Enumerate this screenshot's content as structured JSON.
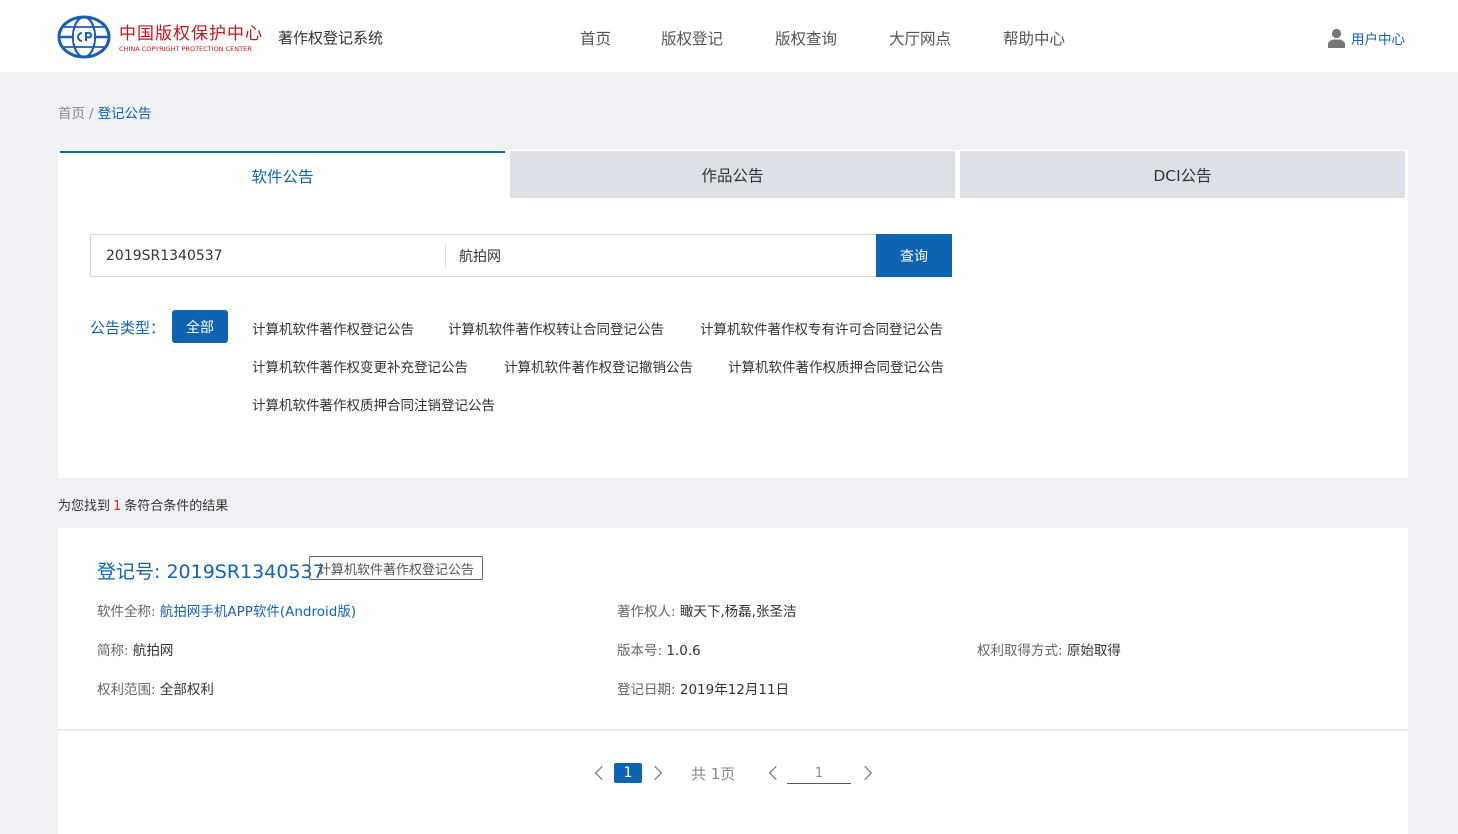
{
  "header": {
    "logo_cn": "中国版权保护中心",
    "logo_en": "CHINA COPYRIGHT PROTECTION CENTER",
    "system_title": "著作权登记系统",
    "nav": [
      {
        "label": "首页"
      },
      {
        "label": "版权登记"
      },
      {
        "label": "版权查询"
      },
      {
        "label": "大厅网点"
      },
      {
        "label": "帮助中心"
      }
    ],
    "user_center": "用户中心"
  },
  "breadcrumb": {
    "home": "首页",
    "separator": "/",
    "current": "登记公告"
  },
  "tabs": [
    {
      "label": "软件公告",
      "active": true
    },
    {
      "label": "作品公告",
      "active": false
    },
    {
      "label": "DCI公告",
      "active": false
    }
  ],
  "search": {
    "registration_value": "2019SR1340537",
    "name_value": "航拍网",
    "button_label": "查询"
  },
  "filter": {
    "label": "公告类型：",
    "all_label": "全部",
    "types": [
      "计算机软件著作权登记公告",
      "计算机软件著作权转让合同登记公告",
      "计算机软件著作权专有许可合同登记公告",
      "计算机软件著作权变更补充登记公告",
      "计算机软件著作权登记撤销公告",
      "计算机软件著作权质押合同登记公告",
      "计算机软件著作权质押合同注销登记公告"
    ]
  },
  "results": {
    "prefix": "为您找到",
    "count": "1",
    "suffix": "条符合条件的结果"
  },
  "record": {
    "reg_no_label": "登记号: 2019SR1340537",
    "badge": "计算机软件著作权登记公告",
    "full_name_key": "软件全称:",
    "full_name_value": "航拍网手机APP软件(Android版)",
    "owner_key": "著作权人:",
    "owner_value": "瞰天下,杨磊,张圣洁",
    "short_name_key": "简称:",
    "short_name_value": "航拍网",
    "version_key": "版本号:",
    "version_value": "1.0.6",
    "acquire_key": "权利取得方式:",
    "acquire_value": "原始取得",
    "scope_key": "权利范围:",
    "scope_value": "全部权利",
    "date_key": "登记日期:",
    "date_value": "2019年12月11日"
  },
  "pagination": {
    "current_page": "1",
    "total_label": "共 1页",
    "jump_value": "1"
  },
  "colors": {
    "primary": "#0e63b3",
    "logo_red": "#c4161c",
    "count_red": "#e02828",
    "background": "#f0f1f5"
  }
}
